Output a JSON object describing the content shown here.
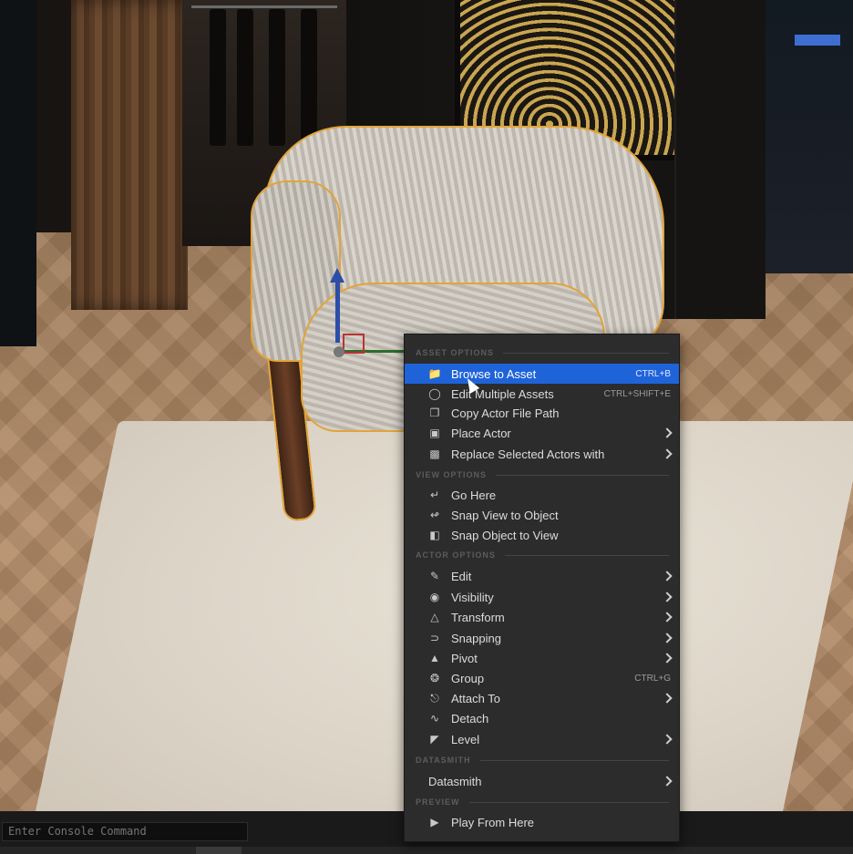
{
  "console": {
    "placeholder": "Enter Console Command"
  },
  "menu": {
    "sections": {
      "asset": "ASSET OPTIONS",
      "view": "VIEW OPTIONS",
      "actor": "ACTOR OPTIONS",
      "datasmith": "DATASMITH",
      "preview": "PREVIEW"
    },
    "asset_items": [
      {
        "label": "Browse to Asset",
        "shortcut": "CTRL+B",
        "icon": "folder-search-icon",
        "highlighted": true
      },
      {
        "label": "Edit Multiple Assets",
        "shortcut": "CTRL+SHIFT+E",
        "icon": "circle-icon"
      },
      {
        "label": "Copy Actor File Path",
        "icon": "copy-icon"
      },
      {
        "label": "Place Actor",
        "icon": "place-actor-icon",
        "submenu": true
      },
      {
        "label": "Replace Selected Actors with",
        "icon": "replace-icon",
        "submenu": true
      }
    ],
    "view_items": [
      {
        "label": "Go Here",
        "icon": "go-here-icon"
      },
      {
        "label": "Snap View to Object",
        "icon": "snap-view-icon"
      },
      {
        "label": "Snap Object to View",
        "icon": "snap-object-icon"
      }
    ],
    "actor_items": [
      {
        "label": "Edit",
        "icon": "pencil-icon",
        "submenu": true
      },
      {
        "label": "Visibility",
        "icon": "eye-icon",
        "submenu": true
      },
      {
        "label": "Transform",
        "icon": "transform-icon",
        "submenu": true
      },
      {
        "label": "Snapping",
        "icon": "magnet-icon",
        "submenu": true
      },
      {
        "label": "Pivot",
        "icon": "pivot-icon",
        "submenu": true
      },
      {
        "label": "Group",
        "shortcut": "CTRL+G",
        "icon": "group-icon"
      },
      {
        "label": "Attach To",
        "icon": "attach-icon",
        "submenu": true
      },
      {
        "label": "Detach",
        "icon": "detach-icon"
      },
      {
        "label": "Level",
        "icon": "level-icon",
        "submenu": true
      }
    ],
    "datasmith_items": [
      {
        "label": "Datasmith",
        "submenu": true
      }
    ],
    "preview_items": [
      {
        "label": "Play From Here",
        "icon": "play-icon"
      }
    ]
  },
  "colors": {
    "menu_bg": "#2c2c2c",
    "highlight": "#1f63d9",
    "selection_outline": "#e2a43a"
  }
}
